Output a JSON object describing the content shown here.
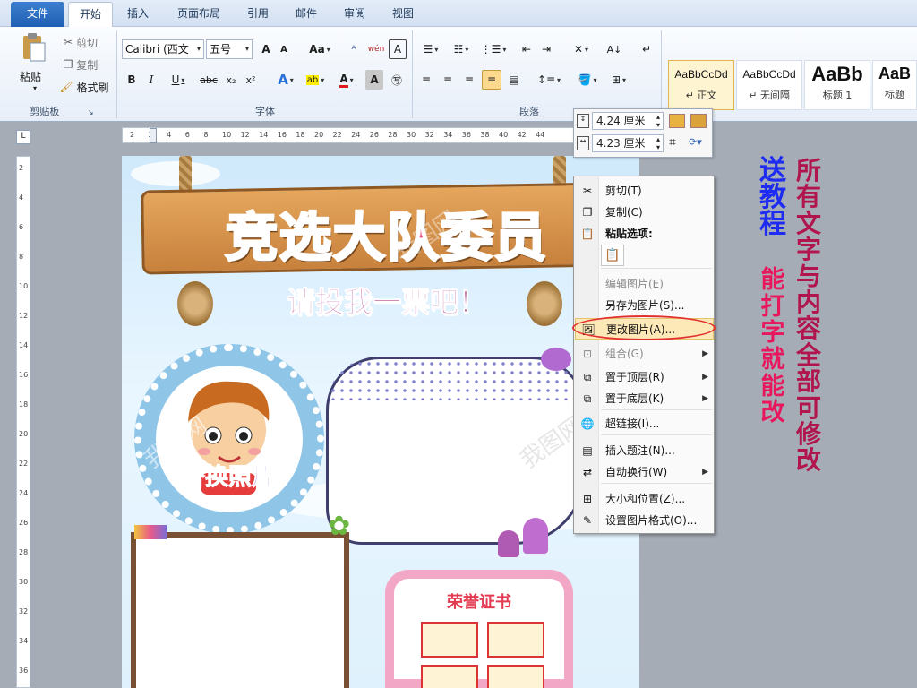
{
  "tabs": {
    "file": "文件",
    "home": "开始",
    "insert": "插入",
    "layout": "页面布局",
    "references": "引用",
    "mailings": "邮件",
    "review": "审阅",
    "view": "视图"
  },
  "clipboard": {
    "paste": "粘贴",
    "cut": "剪切",
    "copy": "复制",
    "format_painter": "格式刷",
    "group": "剪贴板"
  },
  "font": {
    "name": "Calibri (西文",
    "size": "五号",
    "group": "字体",
    "bold": "B",
    "italic": "I",
    "underline": "U",
    "strike": "abc",
    "subscript": "x₂",
    "superscript": "x²",
    "grow": "A",
    "shrink": "A",
    "case": "Aa",
    "phonetic": "wén",
    "border": "A"
  },
  "paragraph": {
    "group": "段落"
  },
  "styles": [
    {
      "sample": "AaBbCcDd",
      "name": "↵ 正文"
    },
    {
      "sample": "AaBbCcDd",
      "name": "↵ 无间隔"
    },
    {
      "sample": "AaBb",
      "name": "标题 1"
    },
    {
      "sample": "AaB",
      "name": "标题"
    }
  ],
  "ruler": {
    "ticks": [
      "2",
      "2",
      "4",
      "6",
      "8",
      "10",
      "12",
      "14",
      "16",
      "18",
      "20",
      "22",
      "24",
      "26",
      "28",
      "30",
      "32",
      "34",
      "36",
      "38",
      "40",
      "42",
      "44"
    ],
    "vticks": [
      "2",
      "4",
      "6",
      "8",
      "10",
      "12",
      "14",
      "16",
      "18",
      "20",
      "22",
      "24",
      "26",
      "28",
      "30",
      "32",
      "34",
      "36"
    ]
  },
  "size_toolbar": {
    "height": "4.24 厘米",
    "width": "4.23 厘米"
  },
  "document": {
    "title": "竞选大队委员",
    "subtitle": "请投我一票吧！",
    "photo_label": "替换照片",
    "certificate_title": "荣誉证书",
    "watermarks": [
      "我图网",
      "我图网",
      "我图网",
      "我图网"
    ]
  },
  "context_menu": [
    {
      "icon": "scissors-icon",
      "glyph": "✂",
      "label": "剪切(T)",
      "disabled": false,
      "submenu": false
    },
    {
      "icon": "copy-icon",
      "glyph": "❐",
      "label": "复制(C)",
      "disabled": false,
      "submenu": false
    },
    {
      "icon": "paste-icon",
      "glyph": "📋",
      "label": "粘贴选项:",
      "disabled": false,
      "submenu": false,
      "bold": true
    },
    {
      "icon": "edit-picture-icon",
      "glyph": "",
      "label": "编辑图片(E)",
      "disabled": true,
      "submenu": false
    },
    {
      "icon": "save-picture-icon",
      "glyph": "",
      "label": "另存为图片(S)...",
      "disabled": false,
      "submenu": false
    },
    {
      "icon": "change-picture-icon",
      "glyph": "🖼",
      "label": "更改图片(A)...",
      "disabled": false,
      "submenu": false
    },
    {
      "icon": "group-icon",
      "glyph": "⊡",
      "label": "组合(G)",
      "disabled": true,
      "submenu": true
    },
    {
      "icon": "bring-front-icon",
      "glyph": "⧉",
      "label": "置于顶层(R)",
      "disabled": false,
      "submenu": true
    },
    {
      "icon": "send-back-icon",
      "glyph": "⧉",
      "label": "置于底层(K)",
      "disabled": false,
      "submenu": true
    },
    {
      "icon": "hyperlink-icon",
      "glyph": "🌐",
      "label": "超链接(I)...",
      "disabled": false,
      "submenu": false
    },
    {
      "icon": "caption-icon",
      "glyph": "▤",
      "label": "插入题注(N)...",
      "disabled": false,
      "submenu": false
    },
    {
      "icon": "text-wrap-icon",
      "glyph": "⇄",
      "label": "自动换行(W)",
      "disabled": false,
      "submenu": true
    },
    {
      "icon": "size-position-icon",
      "glyph": "⊞",
      "label": "大小和位置(Z)...",
      "disabled": false,
      "submenu": false
    },
    {
      "icon": "format-picture-icon",
      "glyph": "✎",
      "label": "设置图片格式(O)...",
      "disabled": false,
      "submenu": false
    }
  ],
  "promo": {
    "left": "送教程",
    "middle": "能打字就能改",
    "right": "所有文字与内容全部可修改"
  },
  "colors": {
    "accent": "#1f5fb3",
    "highlight": "#fcd98d",
    "promo_blue": "#1e2bf0",
    "promo_red": "#e8175d",
    "promo_magenta": "#b1154e"
  }
}
